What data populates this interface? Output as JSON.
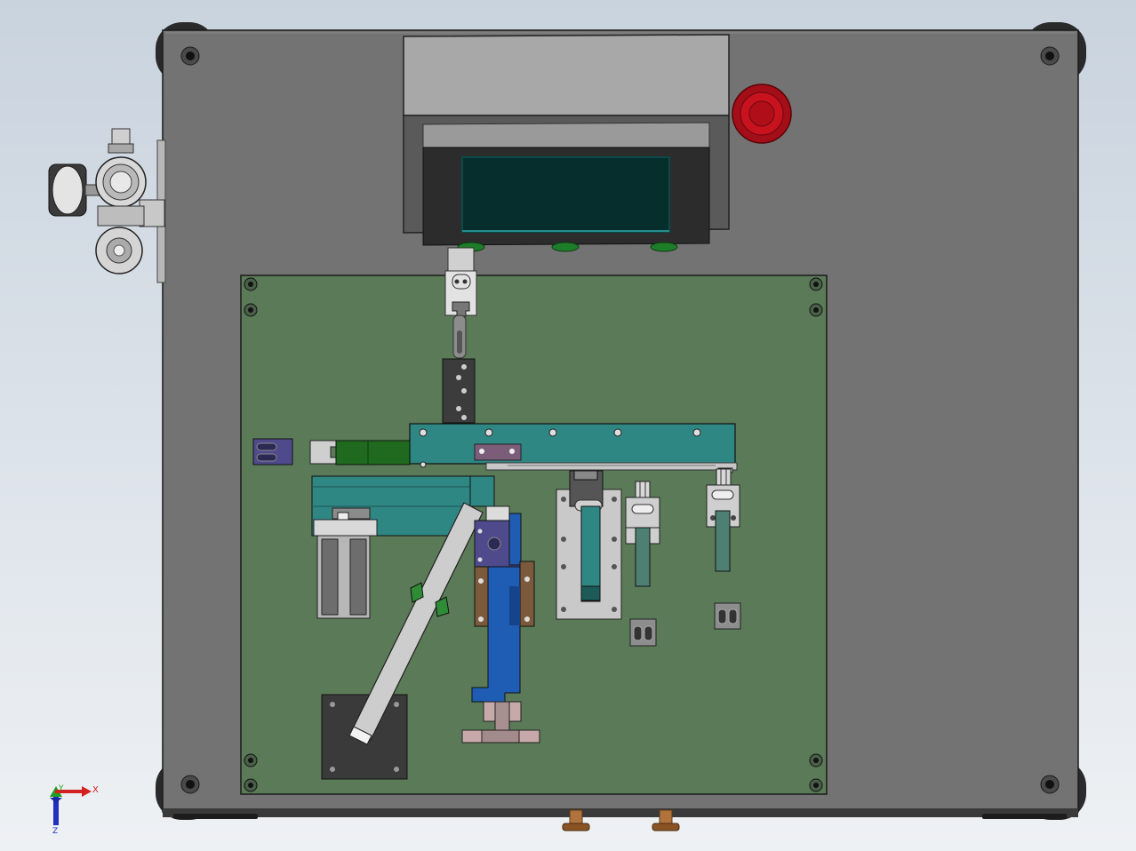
{
  "viewport": {
    "background_top": "#c9d3de",
    "background_bottom": "#eef1f4"
  },
  "colors": {
    "base_plate": "#737373",
    "mount_plate": "#5b7a58",
    "controller_housing": "#a6a6a6",
    "screen": "#062e2c",
    "emergency_stop": "#c4101c",
    "teal_parts": "#2f8784",
    "blue_slider": "#1f5db4",
    "brown_plates": "#7a5a3a",
    "purple_parts": "#4f4a8c",
    "green_buttons": "#1e7d28"
  },
  "icons": {
    "triad": "coordinate-triad-icon",
    "estop": "emergency-stop-icon",
    "gauge": "pressure-gauge-icon",
    "screw": "screw-icon"
  },
  "axis_triad": {
    "x_label": "X",
    "y_label": "Y",
    "z_label": "Z",
    "x_color": "#d42020",
    "y_color": "#20a020",
    "z_color": "#2030c0"
  }
}
